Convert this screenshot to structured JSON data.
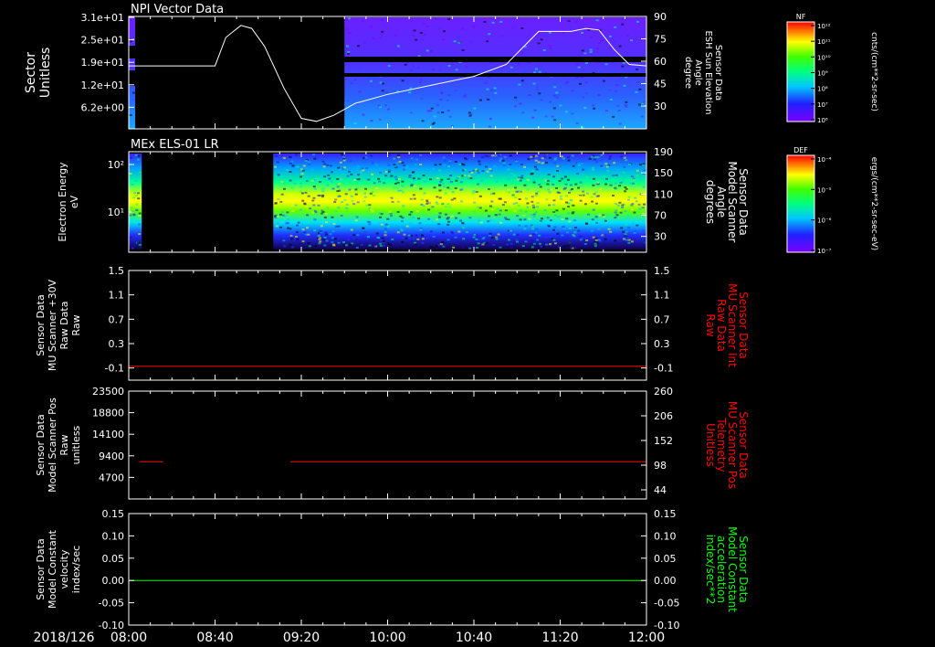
{
  "panels": [
    {
      "id": "npi",
      "title": "NPI Vector Data",
      "left_label": [
        "Sector",
        "Unitless"
      ],
      "left_ticks": [
        {
          "label": "3.1e+01",
          "y": 18
        },
        {
          "label": "2.5e+01",
          "y": 43
        },
        {
          "label": "1.9e+01",
          "y": 68
        },
        {
          "label": "1.2e+01",
          "y": 92
        },
        {
          "label": "6.2e+00",
          "y": 117
        }
      ],
      "right_label": [
        "Sensor Data",
        "ESH Sun Elevation",
        "Angle",
        "degree"
      ],
      "right_ticks": [
        "90",
        "75",
        "60",
        "45",
        "30"
      ],
      "right_range": [
        15,
        90
      ],
      "colorbar": {
        "label": "NF",
        "units": "cnts/(cm**2-sr-sec)",
        "ticks": [
          "10¹²",
          "10¹¹",
          "10¹⁰",
          "10⁹",
          "10⁸",
          "10⁷",
          "10⁶"
        ]
      }
    },
    {
      "id": "els",
      "title": "MEx ELS-01 LR",
      "left_label": [
        "Electron Energy",
        "eV"
      ],
      "left_ticks": [
        {
          "label": "10²"
        },
        {
          "label": "10¹"
        }
      ],
      "right_label": [
        "Sensor Data",
        "Model Scanner",
        "Angle",
        "degrees"
      ],
      "right_ticks": [
        "190",
        "150",
        "110",
        "70",
        "30"
      ],
      "right_range": [
        0,
        190
      ],
      "colorbar": {
        "label": "DEF",
        "units": "ergs/(cm**2-sr-sec-eV)",
        "ticks": [
          "10⁻⁴",
          "10⁻⁵",
          "10⁻⁶",
          "10⁻⁷"
        ]
      }
    },
    {
      "id": "mu_raw",
      "left_label": [
        "Sensor Data",
        "MU Scanner +30V",
        "Raw Data",
        "Raw"
      ],
      "left_ticks": [
        "1.5",
        "1.1",
        "0.7",
        "0.3",
        "-0.1"
      ],
      "left_range": [
        -0.3,
        1.5
      ],
      "right_label": [
        "Sensor Data",
        "MU Scanner Int",
        "Raw Data",
        "Raw"
      ],
      "right_ticks": [
        "1.5",
        "1.1",
        "0.7",
        "0.3",
        "-0.1"
      ]
    },
    {
      "id": "scanner_pos",
      "left_label": [
        "Sensor Data",
        "Model Scanner Pos",
        "Raw",
        "unitless"
      ],
      "left_ticks": [
        "23500",
        "18800",
        "14100",
        "9400",
        "4700"
      ],
      "left_range": [
        0,
        23500
      ],
      "right_label": [
        "Sensor Data",
        "MU Scanner Pos",
        "Telemetry",
        "Unitless"
      ],
      "right_ticks": [
        "260",
        "206",
        "152",
        "98",
        "44"
      ]
    },
    {
      "id": "velocity",
      "left_label": [
        "Sensor Data",
        "Model Constant",
        "velocity",
        "index/sec"
      ],
      "left_ticks": [
        "0.15",
        "0.10",
        "0.05",
        "0.00",
        "-0.05",
        "-0.10"
      ],
      "left_range": [
        -0.1,
        0.15
      ],
      "right_label": [
        "Sensor Data",
        "Model Constant",
        "acceleration",
        "index/sec**2"
      ],
      "right_ticks": [
        "0.15",
        "0.10",
        "0.05",
        "0.00",
        "-0.05",
        "-0.10"
      ]
    }
  ],
  "x_axis": {
    "date_label": "2018/126",
    "ticks": [
      "08:00",
      "08:40",
      "09:20",
      "10:00",
      "10:40",
      "11:20",
      "12:00"
    ]
  },
  "colors": {
    "background": "#000000",
    "axis": "#ffffff",
    "red_trace": "#ff0000",
    "green_trace": "#00ff00"
  },
  "chart_data": [
    {
      "type": "line",
      "panel": "npi",
      "series": [
        {
          "x": [
            "08:00",
            "08:40",
            "08:45",
            "08:52",
            "08:57",
            "09:03",
            "09:12",
            "09:20",
            "09:27",
            "09:35",
            "09:45",
            "10:00",
            "10:20",
            "10:40",
            "10:55",
            "11:10",
            "11:25",
            "11:32",
            "11:38",
            "11:45",
            "11:52",
            "12:00"
          ],
          "y": [
            57,
            57,
            76,
            84,
            82,
            70,
            42,
            22,
            20,
            24,
            32,
            38,
            44,
            50,
            58,
            80,
            80,
            82,
            81,
            68,
            58,
            57
          ],
          "axis": "right"
        }
      ]
    },
    {
      "type": "line",
      "panel": "mu_raw",
      "series": [
        {
          "x": [
            "08:00",
            "12:00"
          ],
          "y": [
            -0.07,
            -0.07
          ]
        }
      ]
    },
    {
      "type": "line",
      "panel": "scanner_pos",
      "series": [
        {
          "x": [
            "08:05",
            "08:16"
          ],
          "y": [
            8100,
            8100
          ]
        },
        {
          "x": [
            "09:15",
            "12:00"
          ],
          "y": [
            8100,
            8100
          ]
        }
      ]
    },
    {
      "type": "line",
      "panel": "velocity",
      "series": [
        {
          "x": [
            "08:00",
            "12:00"
          ],
          "y": [
            0.0,
            0.0
          ]
        }
      ]
    },
    {
      "type": "heatmap",
      "panel": "npi",
      "coverage": [
        [
          "08:00",
          "08:03"
        ],
        [
          "09:40",
          "12:00"
        ]
      ]
    },
    {
      "type": "heatmap",
      "panel": "els",
      "coverage": [
        [
          "08:00",
          "08:06"
        ],
        [
          "09:07",
          "12:00"
        ]
      ]
    }
  ]
}
